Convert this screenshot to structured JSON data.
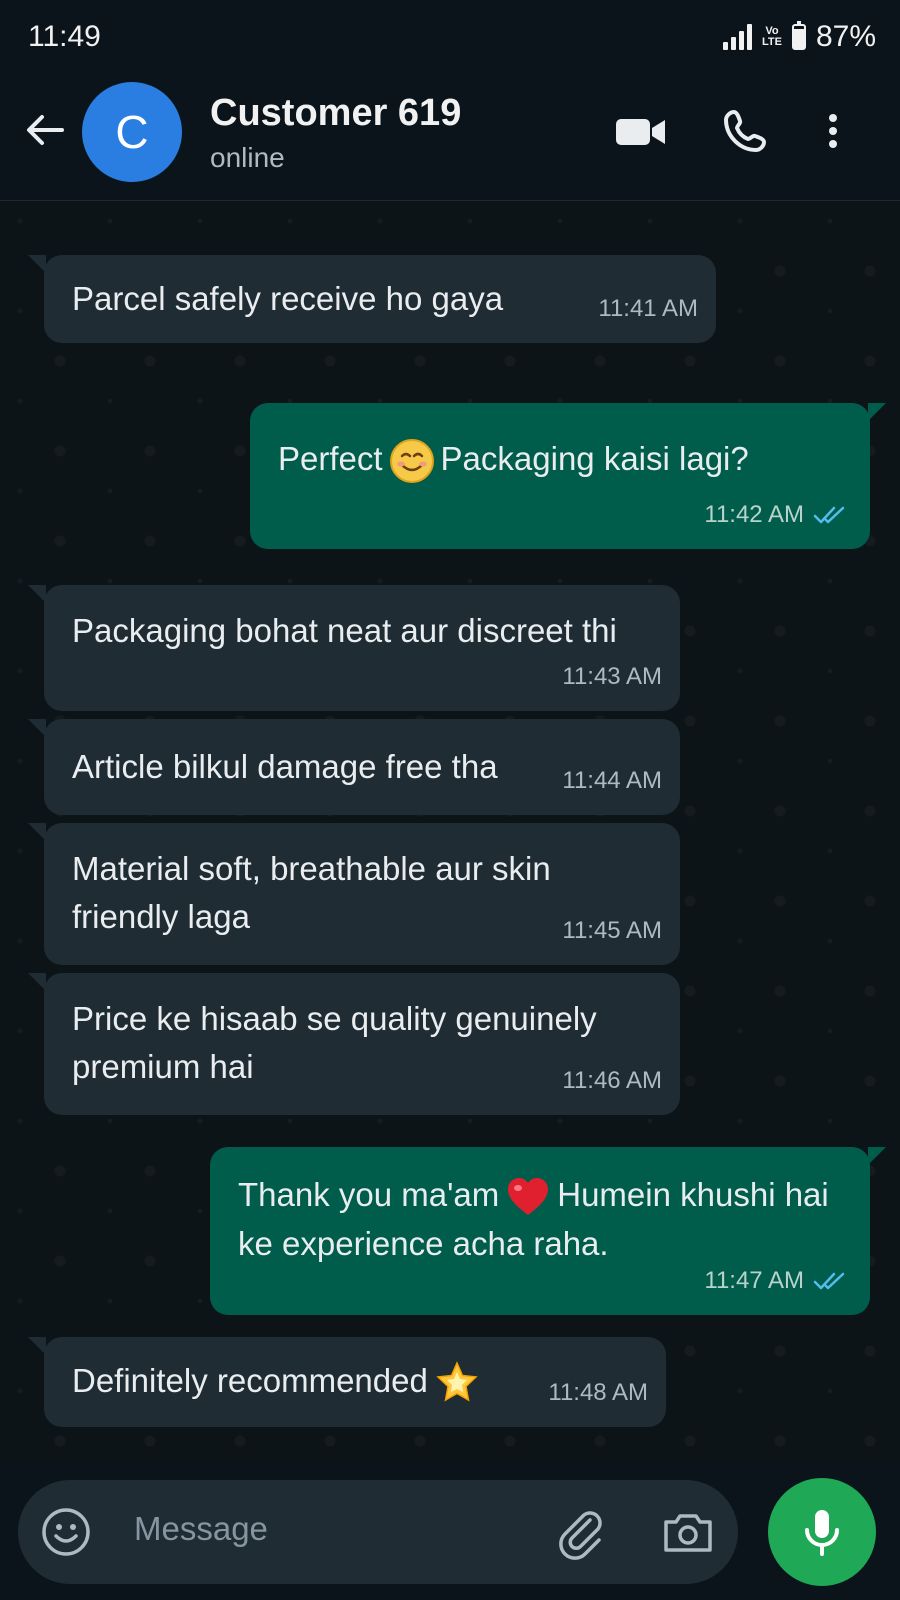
{
  "status_bar": {
    "time": "11:49",
    "network_label": "Vo LTE",
    "battery": "87%",
    "battery_level": 0.87
  },
  "header": {
    "avatar_letter": "C",
    "contact_name": "Customer 619",
    "presence": "online"
  },
  "messages": [
    {
      "direction": "incoming",
      "text": "Parcel safely receive ho gaya",
      "time": "11:41 AM"
    },
    {
      "direction": "outgoing",
      "text_before": "Perfect",
      "emoji": "smiling-face",
      "text_after": "Packaging kaisi lagi?",
      "time": "11:42 AM",
      "status": "read"
    },
    {
      "direction": "incoming",
      "text": "Packaging bohat neat aur discreet thi",
      "time": "11:43 AM"
    },
    {
      "direction": "incoming",
      "text": "Article bilkul damage free tha",
      "time": "11:44 AM"
    },
    {
      "direction": "incoming",
      "text": "Material soft, breathable aur skin friendly laga",
      "time": "11:45 AM"
    },
    {
      "direction": "incoming",
      "text": "Price ke hisaab se quality genuinely premium hai",
      "time": "11:46 AM"
    },
    {
      "direction": "outgoing",
      "text_before": "Thank you ma'am",
      "emoji": "red-heart",
      "text_after": "Humein khushi hai ke experience acha raha.",
      "time": "11:47 AM",
      "status": "read"
    },
    {
      "direction": "incoming",
      "text_before": "Definitely recommended",
      "emoji": "glowing-star",
      "time": "11:48 AM"
    }
  ],
  "composer": {
    "placeholder": "Message"
  },
  "colors": {
    "background": "#0b141a",
    "incoming_bubble": "#1f2c34",
    "outgoing_bubble": "#005c4b",
    "read_ticks": "#53bdeb",
    "mic_button": "#1fa855",
    "avatar": "#2a7de1"
  },
  "icons": [
    "back-arrow-icon",
    "video-call-icon",
    "voice-call-icon",
    "more-options-icon",
    "emoji-icon",
    "attach-icon",
    "camera-icon",
    "mic-icon"
  ]
}
